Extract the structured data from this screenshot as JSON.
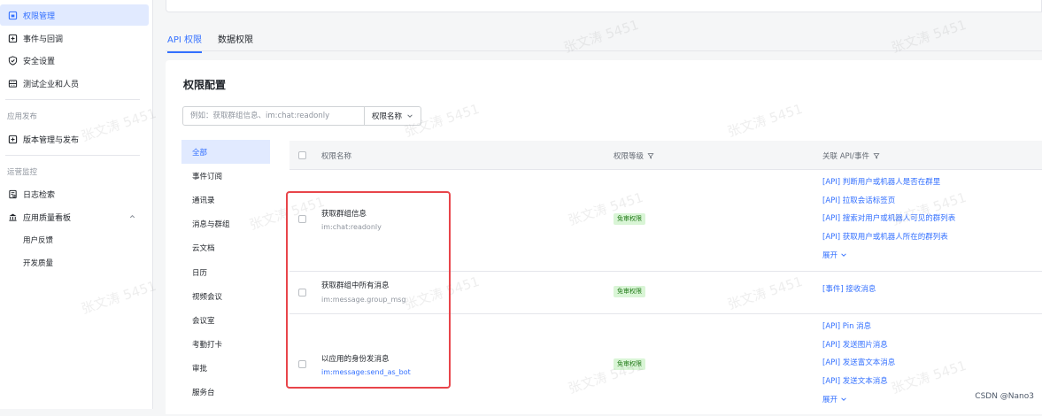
{
  "sidebar": {
    "items": [
      {
        "label": "权限管理",
        "active": true
      },
      {
        "label": "事件与回调"
      },
      {
        "label": "安全设置"
      },
      {
        "label": "测试企业和人员"
      }
    ],
    "group_publish": "应用发布",
    "publish_item": "版本管理与发布",
    "group_ops": "运营监控",
    "log_item": "日志检索",
    "dashboard_item": "应用质量看板",
    "sub_items": [
      "用户反馈",
      "开发质量"
    ]
  },
  "tabs": [
    "API 权限",
    "数据权限"
  ],
  "card": {
    "title": "权限配置",
    "search_placeholder": "例如：获取群组信息、im:chat:readonly",
    "search_select": "权限名称"
  },
  "categories": [
    "全部",
    "事件订阅",
    "通讯录",
    "消息与群组",
    "云文档",
    "日历",
    "视频会议",
    "会议室",
    "考勤打卡",
    "审批",
    "服务台"
  ],
  "table": {
    "headers": {
      "name": "权限名称",
      "level": "权限等级",
      "related": "关联 API/事件"
    },
    "rows": [
      {
        "name": "获取群组信息",
        "code": "im:chat:readonly",
        "badge": "免审权限",
        "links": [
          "[API] 判断用户或机器人是否在群里",
          "[API] 拉取会话标签页",
          "[API] 搜索对用户或机器人可见的群列表",
          "[API] 获取用户或机器人所在的群列表"
        ],
        "expand": "展开"
      },
      {
        "name": "获取群组中所有消息",
        "code": "im:message.group_msg",
        "badge": "免审权限",
        "links": [
          "[事件] 接收消息"
        ]
      },
      {
        "name": "以应用的身份发消息",
        "code": "im:message:send_as_bot",
        "badge": "免审权限",
        "links": [
          "[API] Pin 消息",
          "[API] 发送图片消息",
          "[API] 发送富文本消息",
          "[API] 发送文本消息"
        ],
        "expand": "展开"
      }
    ]
  },
  "watermark": "张文涛 5451",
  "credit": "CSDN @Nano3",
  "colors": {
    "accent": "#3370ff",
    "highlight": "#e8454a",
    "badge_bg": "#d9f5d6",
    "badge_text": "#237b19"
  }
}
